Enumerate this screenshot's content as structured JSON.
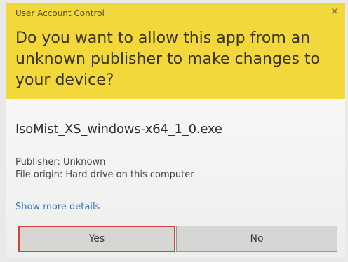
{
  "dialog": {
    "title": "User Account Control",
    "close_glyph": "✕",
    "question": "Do you want to allow this app from an unknown publisher to make changes to your device?",
    "app_name": "IsoMist_XS_windows-x64_1_0.exe",
    "publisher": "Publisher: Unknown",
    "file_origin": "File origin: Hard drive on this computer",
    "details_link": "Show more details",
    "buttons": {
      "yes": "Yes",
      "no": "No"
    }
  },
  "colors": {
    "header_bg": "#f2d83a",
    "link": "#2d79c7",
    "yes_border": "#d2453f"
  }
}
